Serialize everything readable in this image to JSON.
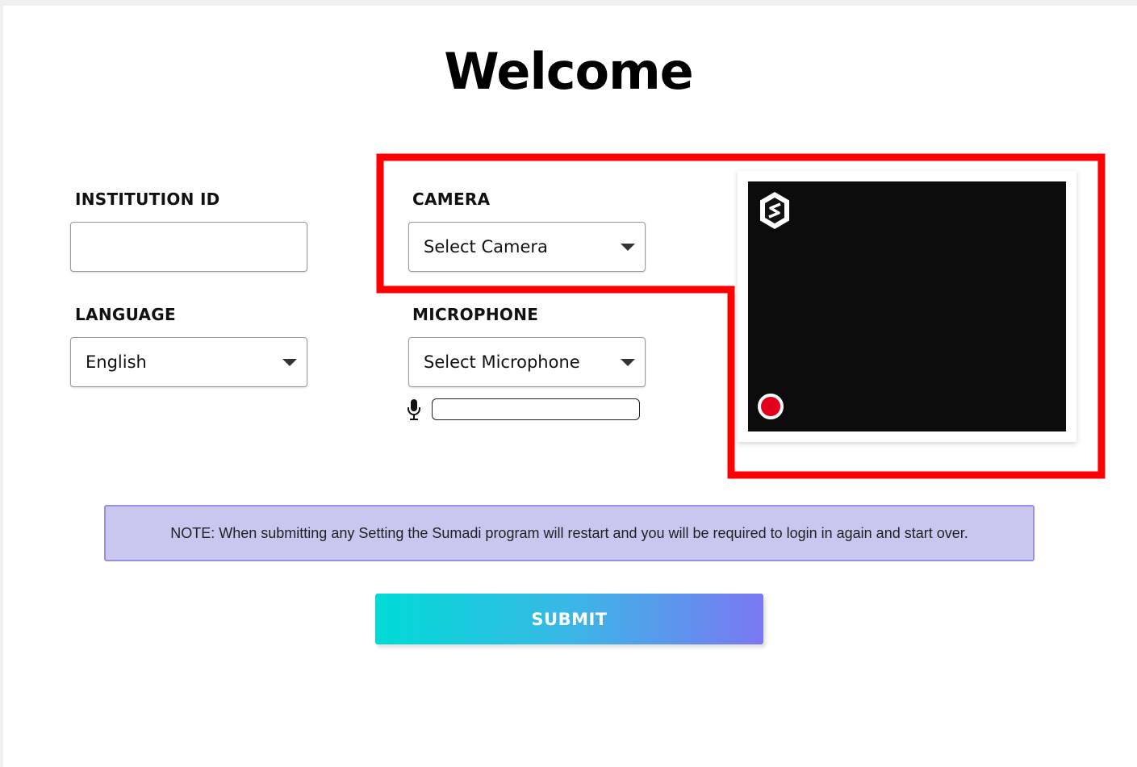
{
  "page": {
    "title": "Welcome"
  },
  "form": {
    "institution_id": {
      "label": "INSTITUTION ID",
      "value": "",
      "placeholder": ""
    },
    "language": {
      "label": "LANGUAGE",
      "selected": "English"
    },
    "camera": {
      "label": "CAMERA",
      "selected": "Select Camera"
    },
    "microphone": {
      "label": "MICROPHONE",
      "selected": "Select Microphone",
      "level": 0
    }
  },
  "preview": {
    "logo_icon": "sumadi-logo-icon",
    "record_icon": "record-indicator-icon"
  },
  "note": {
    "text": "NOTE: When submitting any Setting the Sumadi program will restart and you will be required to login in again and start over."
  },
  "submit": {
    "label": "SUBMIT"
  },
  "annotation": {
    "color": "#ff0000"
  },
  "colors": {
    "note_bg": "#c9c6f0",
    "note_border": "#9a8fe0",
    "submit_gradient": [
      "#00dbd6",
      "#3ab7e6",
      "#7b78f2"
    ],
    "record": "#e3001b"
  }
}
